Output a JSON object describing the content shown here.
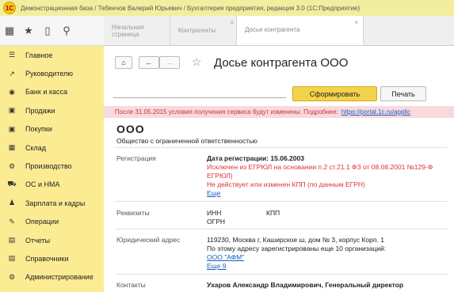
{
  "window": {
    "title": "Демонстрационная база / Тебенчов Валерий Юрьевич / Бухгалтерия предприятия, редакция 3.0 (1С:Предприятие)"
  },
  "toolbar": {
    "icons": [
      "apps-grid-icon",
      "star-icon",
      "history-icon",
      "search-icon"
    ]
  },
  "tabs": [
    {
      "label": "Начальная страница"
    },
    {
      "label": "Контрагенты"
    },
    {
      "label": "Досье контрагента"
    }
  ],
  "sidebar": {
    "items": [
      {
        "label": "Главное",
        "icon": "menu-icon"
      },
      {
        "label": "Руководителю",
        "icon": "chart-icon"
      },
      {
        "label": "Банк и касса",
        "icon": "bank-icon"
      },
      {
        "label": "Продажи",
        "icon": "sales-icon"
      },
      {
        "label": "Покупки",
        "icon": "purchases-icon"
      },
      {
        "label": "Склад",
        "icon": "warehouse-icon"
      },
      {
        "label": "Производство",
        "icon": "production-icon"
      },
      {
        "label": "ОС и НМА",
        "icon": "assets-icon"
      },
      {
        "label": "Зарплата и кадры",
        "icon": "staff-icon"
      },
      {
        "label": "Операции",
        "icon": "operations-icon"
      },
      {
        "label": "Отчеты",
        "icon": "reports-icon"
      },
      {
        "label": "Справочники",
        "icon": "directories-icon"
      },
      {
        "label": "Администрирование",
        "icon": "admin-icon"
      }
    ]
  },
  "page": {
    "title": "Досье контрагента ООО",
    "form_button": "Сформировать",
    "print_button": "Печать",
    "notice_text": "После 31.05.2015 условия получения сервиса будут изменены. Подробнее:",
    "notice_link": "https://portal.1c.ru/applic",
    "company_name": "ООО",
    "company_type": "Общество с ограниченной ответственностью",
    "registration": {
      "label": "Регистрация",
      "date_line": "Дата регистрации: 15.06.2003",
      "excluded_line1": "Исключен из ЕГРЮЛ на основании п.2 ст.21.1 ФЗ от 08.08.2001 №129-Ф",
      "excluded_line2": "ЕГРЮЛ)",
      "kpp_line": "Не действует или изменен КПП (по данным ЕГРН)",
      "more": "Еще"
    },
    "requisites": {
      "label": "Реквизиты",
      "inn": "ИНН",
      "kpp": "КПП",
      "ogrn": "ОГРН"
    },
    "address": {
      "label": "Юридический адрес",
      "value": "119230, Москва г, Каширское ш, дом № 3, корпус Корп. 1",
      "registered": "По этому адресу зарегистрированы еще 10 организаций:",
      "org": "ООО \"АФМ\"",
      "more": "Еще 9"
    },
    "contacts": {
      "label": "Контакты",
      "value": "Ухаров Александр Владимирович, Генеральный директор"
    }
  }
}
